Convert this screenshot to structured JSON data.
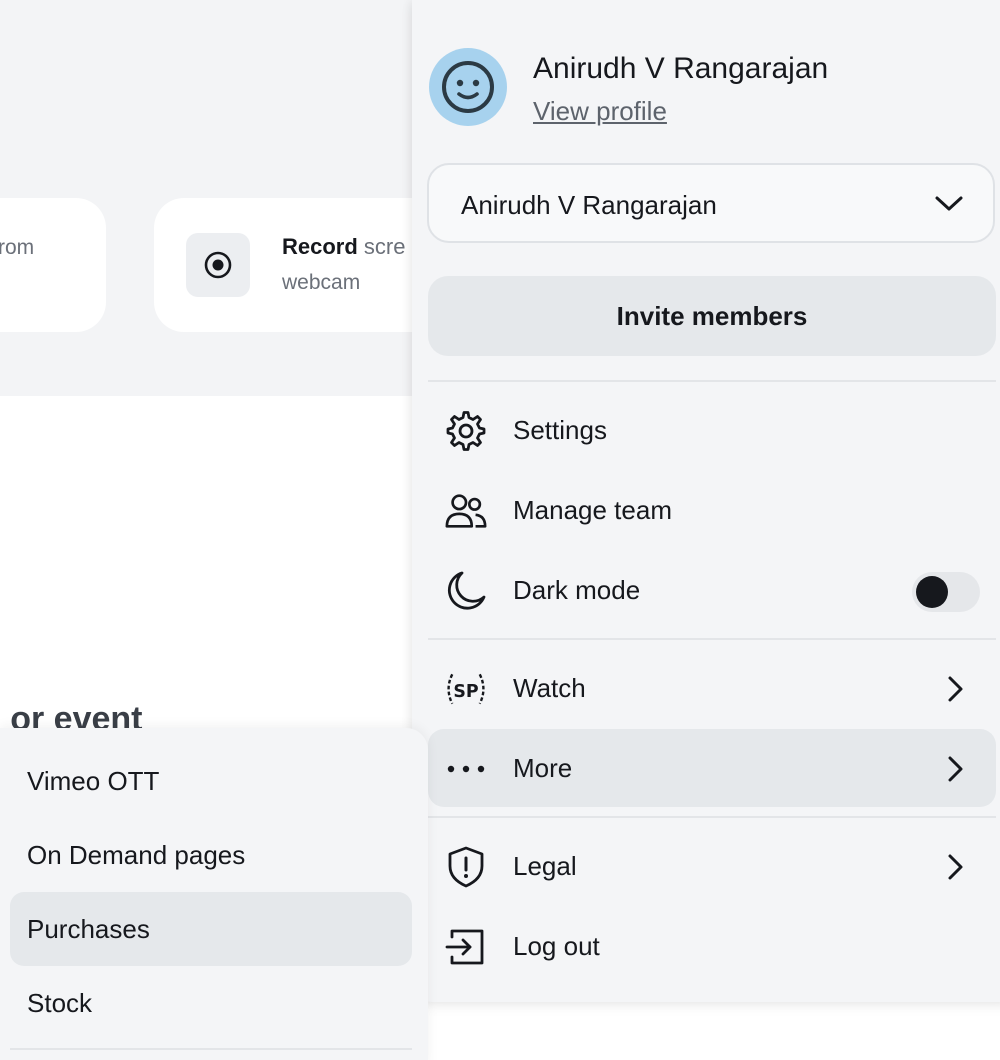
{
  "background": {
    "left_card_snippet": "rom",
    "record_card": {
      "title_bold": "Record",
      "title_rest": " scre",
      "subtitle": "webcam",
      "icon": "record-icon"
    },
    "heading_partial": "o or event"
  },
  "account_menu": {
    "user": {
      "name": "Anirudh V Rangarajan",
      "view_profile": "View profile",
      "avatar_icon": "smiley-avatar-icon",
      "avatar_color": "#a7d2ee"
    },
    "team_select": {
      "value": "Anirudh V Rangarajan",
      "icon": "chevron-down-icon"
    },
    "invite_button": "Invite members",
    "items": [
      {
        "label": "Settings",
        "icon": "gear-icon"
      },
      {
        "label": "Manage team",
        "icon": "users-icon"
      },
      {
        "label": "Dark mode",
        "icon": "moon-icon",
        "toggle_on": false
      },
      {
        "label": "Watch",
        "icon": "sp-watch-icon",
        "has_arrow": true
      },
      {
        "label": "More",
        "icon": "more-dots-icon",
        "has_arrow": true,
        "active": true
      },
      {
        "label": "Legal",
        "icon": "shield-icon",
        "has_arrow": true
      },
      {
        "label": "Log out",
        "icon": "log-out-icon"
      }
    ]
  },
  "more_submenu": {
    "items": [
      {
        "label": "Vimeo OTT"
      },
      {
        "label": "On Demand pages"
      },
      {
        "label": "Purchases",
        "active": true
      },
      {
        "label": "Stock"
      }
    ]
  },
  "colors": {
    "text": "#16181d",
    "muted": "#6b7079",
    "menu_bg": "#f4f5f7",
    "active_bg": "#e5e8eb"
  }
}
